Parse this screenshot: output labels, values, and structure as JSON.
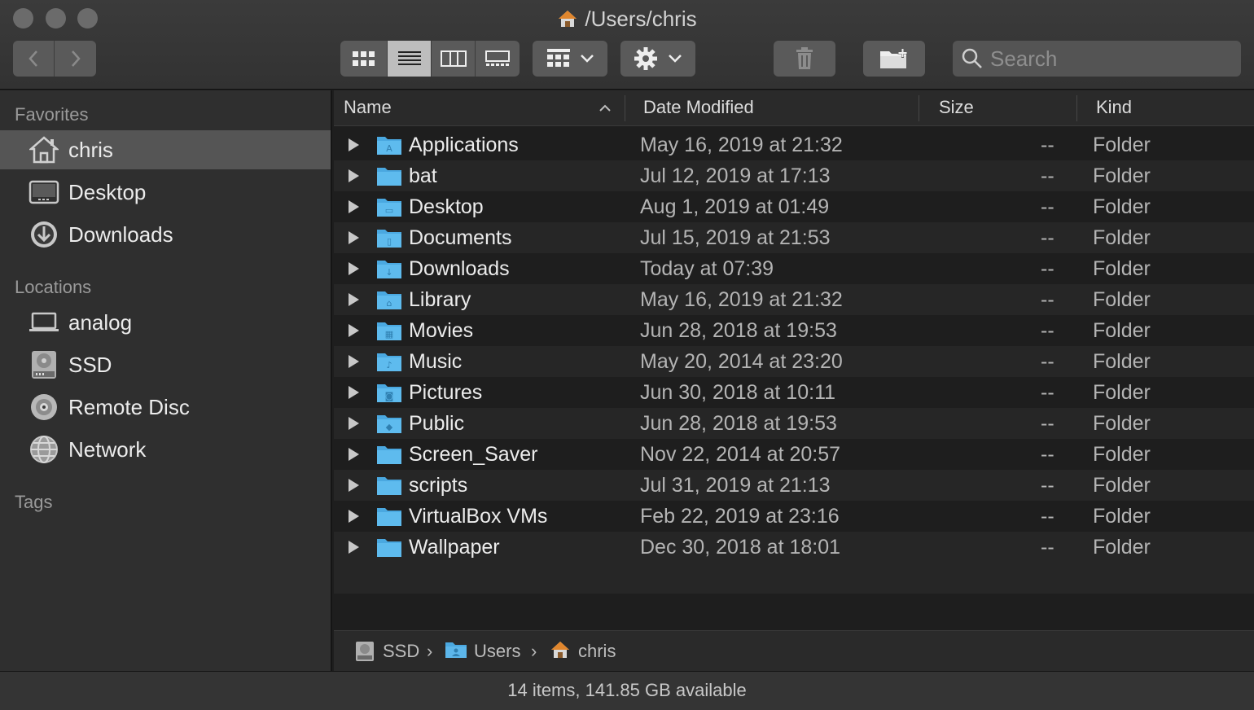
{
  "window": {
    "title": "/Users/chris"
  },
  "toolbar": {
    "search_placeholder": "Search"
  },
  "sidebar": {
    "favorites_heading": "Favorites",
    "locations_heading": "Locations",
    "tags_heading": "Tags",
    "favorites": [
      {
        "label": "chris",
        "icon": "home-icon",
        "selected": true
      },
      {
        "label": "Desktop",
        "icon": "desktop-icon"
      },
      {
        "label": "Downloads",
        "icon": "downloads-icon"
      }
    ],
    "locations": [
      {
        "label": "analog",
        "icon": "laptop-icon"
      },
      {
        "label": "SSD",
        "icon": "hard-drive-icon"
      },
      {
        "label": "Remote Disc",
        "icon": "disc-icon"
      },
      {
        "label": "Network",
        "icon": "network-icon"
      }
    ]
  },
  "columns": {
    "name": "Name",
    "date": "Date Modified",
    "size": "Size",
    "kind": "Kind"
  },
  "files": [
    {
      "name": "Applications",
      "date": "May 16, 2019 at 21:32",
      "size": "--",
      "kind": "Folder",
      "glyph": "A"
    },
    {
      "name": "bat",
      "date": "Jul 12, 2019 at 17:13",
      "size": "--",
      "kind": "Folder",
      "glyph": ""
    },
    {
      "name": "Desktop",
      "date": "Aug 1, 2019 at 01:49",
      "size": "--",
      "kind": "Folder",
      "glyph": "▭"
    },
    {
      "name": "Documents",
      "date": "Jul 15, 2019 at 21:53",
      "size": "--",
      "kind": "Folder",
      "glyph": "▯"
    },
    {
      "name": "Downloads",
      "date": "Today at 07:39",
      "size": "--",
      "kind": "Folder",
      "glyph": "↓"
    },
    {
      "name": "Library",
      "date": "May 16, 2019 at 21:32",
      "size": "--",
      "kind": "Folder",
      "glyph": "⌂"
    },
    {
      "name": "Movies",
      "date": "Jun 28, 2018 at 19:53",
      "size": "--",
      "kind": "Folder",
      "glyph": "▦"
    },
    {
      "name": "Music",
      "date": "May 20, 2014 at 23:20",
      "size": "--",
      "kind": "Folder",
      "glyph": "♪"
    },
    {
      "name": "Pictures",
      "date": "Jun 30, 2018 at 10:11",
      "size": "--",
      "kind": "Folder",
      "glyph": "◙"
    },
    {
      "name": "Public",
      "date": "Jun 28, 2018 at 19:53",
      "size": "--",
      "kind": "Folder",
      "glyph": "◆"
    },
    {
      "name": "Screen_Saver",
      "date": "Nov 22, 2014 at 20:57",
      "size": "--",
      "kind": "Folder",
      "glyph": ""
    },
    {
      "name": "scripts",
      "date": "Jul 31, 2019 at 21:13",
      "size": "--",
      "kind": "Folder",
      "glyph": ""
    },
    {
      "name": "VirtualBox VMs",
      "date": "Feb 22, 2019 at 23:16",
      "size": "--",
      "kind": "Folder",
      "glyph": ""
    },
    {
      "name": "Wallpaper",
      "date": "Dec 30, 2018 at 18:01",
      "size": "--",
      "kind": "Folder",
      "glyph": ""
    }
  ],
  "pathbar": {
    "crumbs": [
      "SSD",
      "Users",
      "chris"
    ],
    "separator": "›"
  },
  "status": {
    "text": "14 items, 141.85 GB available"
  },
  "colors": {
    "folder": "#4aa8e0",
    "selected_row": "#555555",
    "home_roof": "#e0862d"
  }
}
